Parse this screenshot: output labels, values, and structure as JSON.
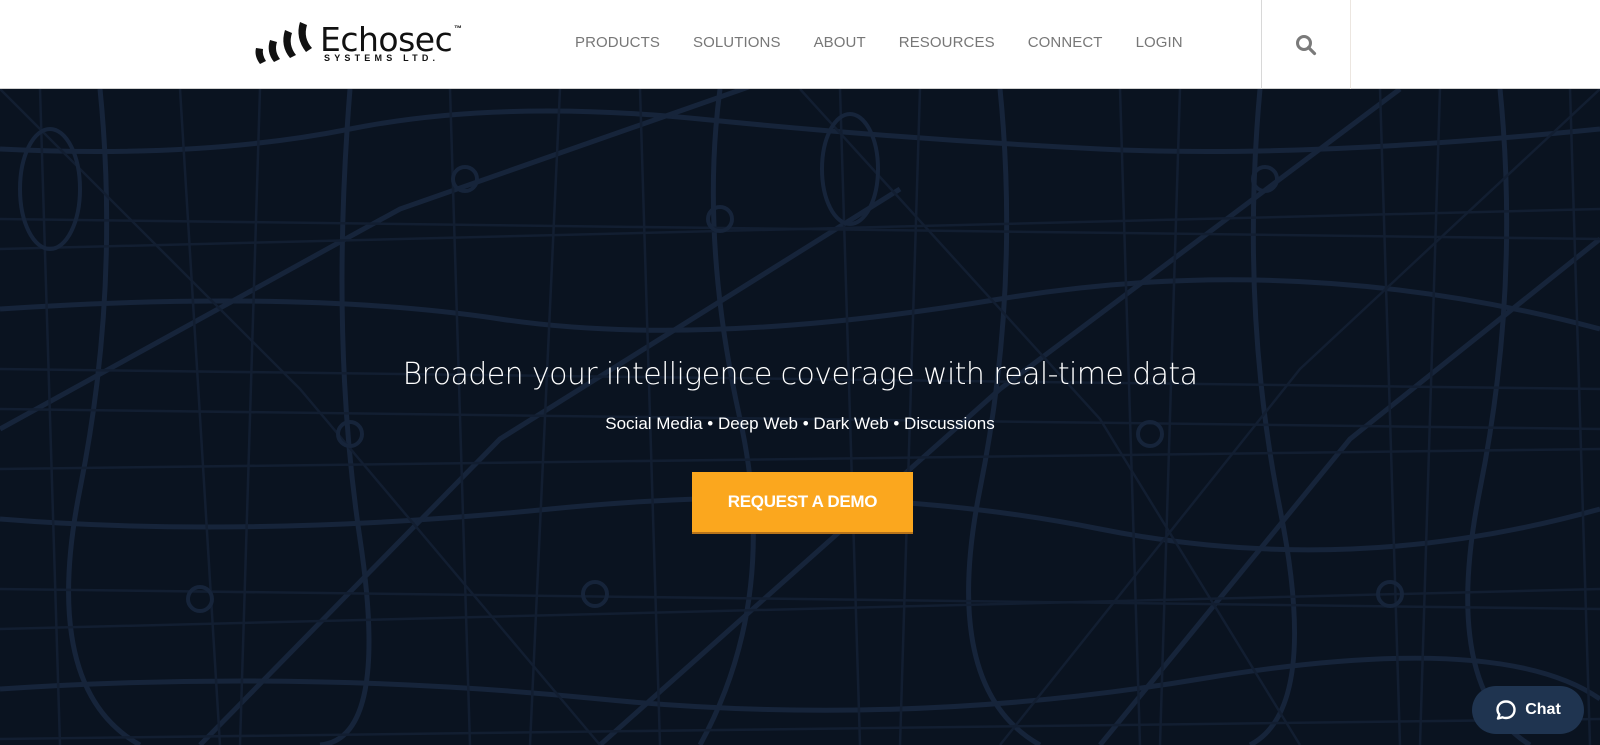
{
  "brand": {
    "name": "Echosec",
    "trademark": "™",
    "tagline": "SYSTEMS LTD."
  },
  "nav": {
    "items": [
      {
        "label": "PRODUCTS"
      },
      {
        "label": "SOLUTIONS"
      },
      {
        "label": "ABOUT"
      },
      {
        "label": "RESOURCES"
      },
      {
        "label": "CONNECT"
      },
      {
        "label": "LOGIN"
      }
    ],
    "search_icon": "search-icon"
  },
  "hero": {
    "title": "Broaden your intelligence coverage with real-time data",
    "subtitle": "Social Media • Deep Web • Dark Web • Discussions",
    "cta_label": "REQUEST A DEMO",
    "background": "city-map-pattern"
  },
  "chat": {
    "label": "Chat",
    "icon": "chat-bubble-icon"
  },
  "colors": {
    "accent": "#fba71e",
    "hero_bg": "#0a1320",
    "map_lines": "#1a2a40",
    "chat_bg": "#1f3450",
    "nav_text": "#777777"
  }
}
